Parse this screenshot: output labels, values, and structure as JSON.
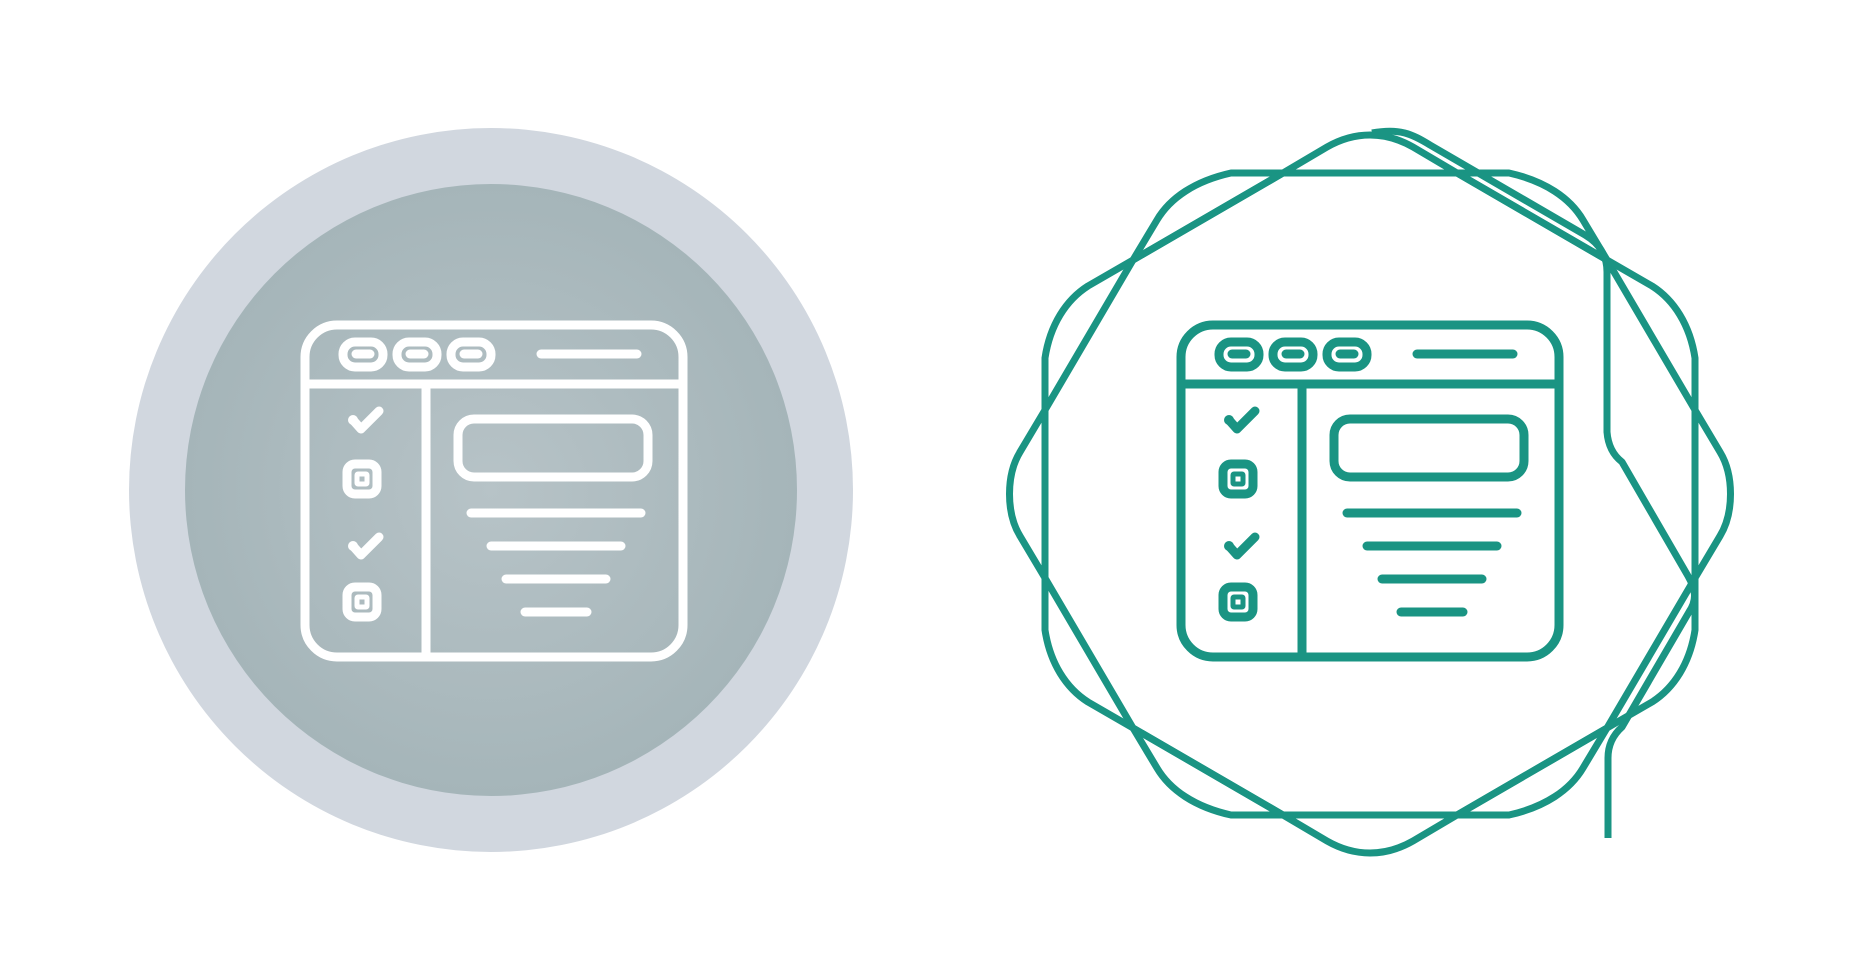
{
  "icons": [
    {
      "name": "browser-checklist-icon-filled",
      "variant": "filled-circle",
      "outer_color": "#d1d7df",
      "inner_color_center": "#b7c3c7",
      "inner_color_edge": "#a5b5b9",
      "stroke_color": "#ffffff"
    },
    {
      "name": "browser-checklist-icon-outline",
      "variant": "outline-badge",
      "stroke_color": "#1a9483"
    }
  ]
}
